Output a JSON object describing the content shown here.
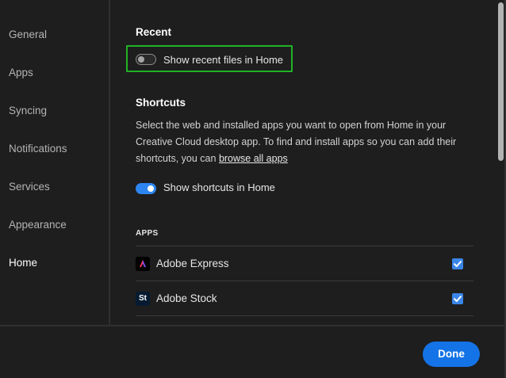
{
  "sidebar": {
    "items": [
      {
        "label": "General"
      },
      {
        "label": "Apps"
      },
      {
        "label": "Syncing"
      },
      {
        "label": "Notifications"
      },
      {
        "label": "Services"
      },
      {
        "label": "Appearance"
      },
      {
        "label": "Home",
        "active": true
      }
    ]
  },
  "main": {
    "recent": {
      "title": "Recent",
      "toggle_label": "Show recent files in Home",
      "toggle_on": false
    },
    "shortcuts": {
      "title": "Shortcuts",
      "description": "Select the web and installed apps you want to open from Home in your Creative Cloud desktop app. To find and install apps so you can add their shortcuts, you can",
      "link_text": "browse all apps",
      "toggle_label": "Show shortcuts in Home",
      "toggle_on": true
    },
    "apps": {
      "heading": "APPS",
      "rows": [
        {
          "icon": "adobe-express-icon",
          "icon_text": "A",
          "name": "Adobe Express",
          "checked": true,
          "icon_color": "#000000"
        },
        {
          "icon": "adobe-stock-icon",
          "icon_text": "St",
          "name": "Adobe Stock",
          "checked": true,
          "icon_color": "#061b31"
        }
      ]
    }
  },
  "footer": {
    "done_label": "Done"
  },
  "colors": {
    "accent": "#1473e6",
    "toggle_on": "#2d86f0",
    "highlight": "#21b227"
  }
}
